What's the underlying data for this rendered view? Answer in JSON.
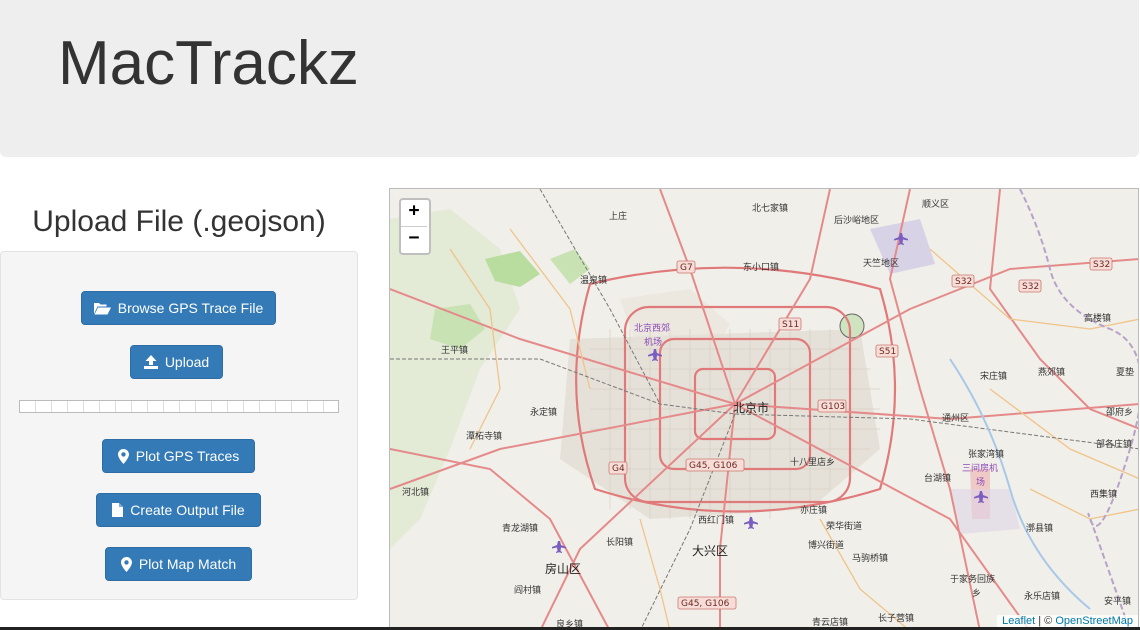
{
  "header": {
    "title": "MacTrackz"
  },
  "upload": {
    "heading": "Upload File (.geojson)",
    "browse_label": "Browse GPS Trace File",
    "upload_label": "Upload",
    "progress": 0,
    "plot_traces_label": "Plot GPS Traces",
    "create_output_label": "Create Output File",
    "plot_map_match_label": "Plot Map Match"
  },
  "map": {
    "zoom_in": "+",
    "zoom_out": "−",
    "attribution": {
      "leaflet": "Leaflet",
      "separator": " | © ",
      "osm": "OpenStreetMap"
    },
    "labels": {
      "shangzhuang": "上庄",
      "beiqijia": "北七家镇",
      "houshayu": "后沙峪地区",
      "shunyi": "顺义区",
      "wenquan": "温泉镇",
      "dongxiaokou": "东小口镇",
      "tianzhu": "天竺地区",
      "wangping": "王平镇",
      "beijing_xijiao_1": "北京西郊",
      "beijing_xijiao_2": "机场",
      "gaoliying": "高楼镇",
      "songzhuang": "宋庄镇",
      "yanjiao": "燕郊镇",
      "xiadian": "夏垫",
      "yongding": "永定镇",
      "beijing": "北京市",
      "tongzhou": "通州区",
      "shaofu": "邵府乡",
      "tanzhesi": "潭柘寺镇",
      "bugezhuang": "部各庄镇",
      "shibalidian": "十八里店乡",
      "zhangjiawan": "张家湾镇",
      "sanjianfang_1": "三间房机",
      "sanjianfang_2": "场",
      "hebei": "河北镇",
      "taihu": "台湖镇",
      "xiji": "西集镇",
      "xihongmen": "西红门镇",
      "yizhuang": "亦庄镇",
      "qinglonghu": "青龙湖镇",
      "changyang": "长阳镇",
      "ronghua": "荣华街道",
      "boxing": "博兴街道",
      "daxing": "大兴区",
      "majuqiao": "马驹桥镇",
      "lixian": "漷县镇",
      "fangshan": "房山区",
      "yujiafu_1": "于家务回族",
      "yujiafu_2": "乡",
      "yonglediandian": "永乐店镇",
      "yanzhuang": "阎村镇",
      "anping": "安平镇",
      "liangxiang": "良乡镇",
      "qingyun": "青云店镇",
      "changziying": "长子营镇"
    },
    "shields": {
      "g7": "G7",
      "s11": "S11",
      "s51": "S51",
      "s32a": "S32",
      "s32b": "S32",
      "g103": "G103",
      "g4": "G4",
      "g45a": "G45, G106",
      "g45b": "G45, G106"
    }
  }
}
